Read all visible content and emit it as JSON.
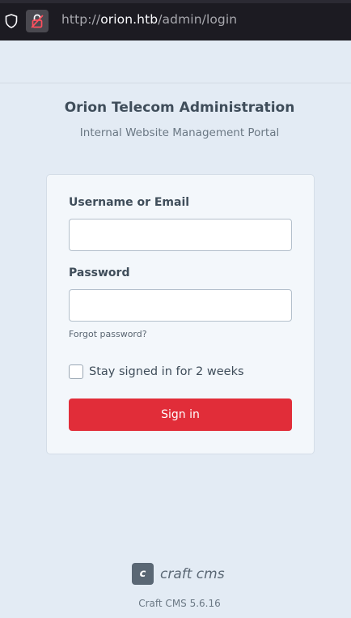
{
  "browser": {
    "url_prefix": "http://",
    "url_host": "orion.htb",
    "url_path": "/admin/login"
  },
  "header": {
    "title": "Orion Telecom Administration",
    "subtitle": "Internal Website Management Portal"
  },
  "login_form": {
    "username_label": "Username or Email",
    "username_value": "",
    "password_label": "Password",
    "password_value": "",
    "forgot_password": "Forgot password?",
    "remember_label": "Stay signed in for 2 weeks",
    "remember_checked": false,
    "submit_label": "Sign in"
  },
  "footer": {
    "logo_glyph": "c",
    "logo_text": "craft cms",
    "version": "Craft CMS 5.6.16"
  },
  "colors": {
    "background": "#e3ebf4",
    "card": "#f3f7fb",
    "primary_button": "#e12d39",
    "browser_bar": "#1c1b22"
  },
  "icons": {
    "tracking_protection": "shield-icon",
    "connection_status": "insecure-lock-icon"
  }
}
